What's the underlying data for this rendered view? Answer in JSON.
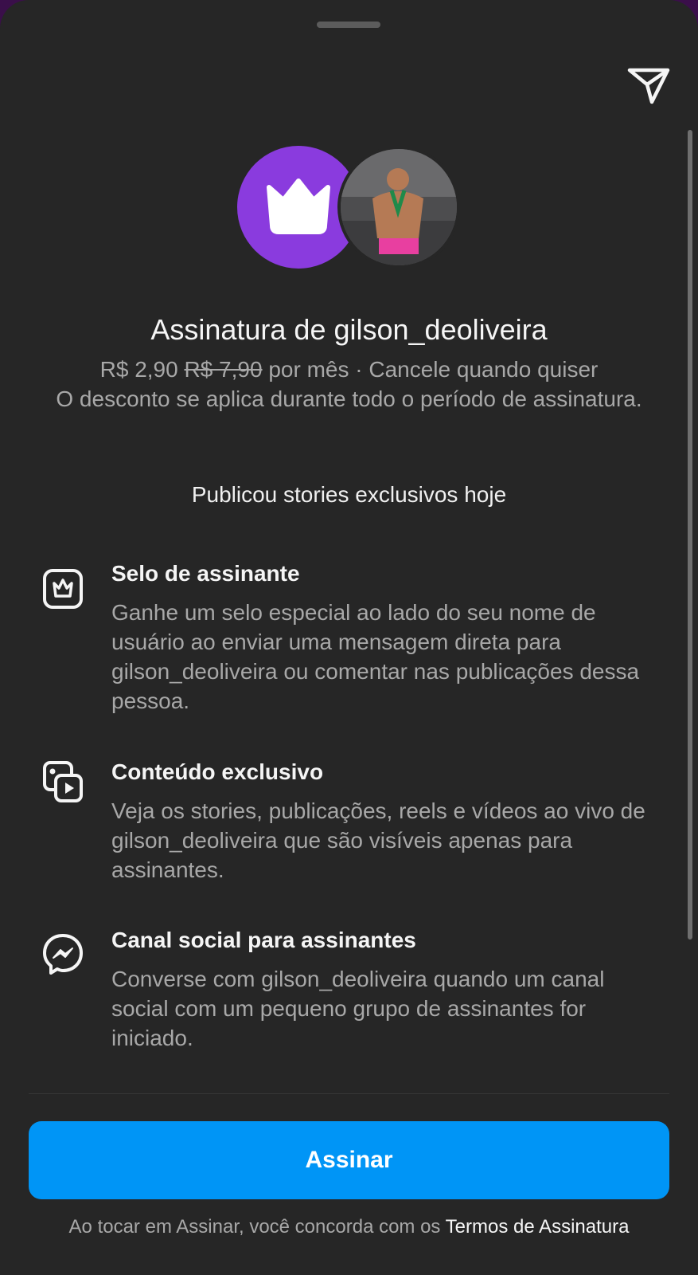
{
  "header": {
    "share_icon": "send-icon"
  },
  "hero": {
    "crown_icon": "crown-icon",
    "avatar_alt": "gilson_deoliveira",
    "accent": "#8a3bde"
  },
  "subscription": {
    "title": "Assinatura de gilson_deoliveira",
    "price": "R$ 2,90",
    "old_price": "R$ 7,90",
    "price_suffix": " por mês · Cancele quando quiser",
    "discount_note": "O desconto se aplica durante todo o período de assinatura.",
    "activity": "Publicou stories exclusivos hoje"
  },
  "features": [
    {
      "icon": "badge-crown-icon",
      "title": "Selo de assinante",
      "description": "Ganhe um selo especial ao lado do seu nome de usuário ao enviar uma mensagem direta para gilson_deoliveira ou comentar nas publicações dessa pessoa."
    },
    {
      "icon": "exclusive-content-icon",
      "title": "Conteúdo exclusivo",
      "description": "Veja os stories, publicações, reels e vídeos ao vivo de gilson_deoliveira que são visíveis apenas para assinantes."
    },
    {
      "icon": "messenger-icon",
      "title": "Canal social para assinantes",
      "description": "Converse com gilson_deoliveira quando um canal social com um pequeno grupo de assinantes for iniciado."
    }
  ],
  "cta": {
    "label": "Assinar",
    "color": "#0095f6"
  },
  "terms": {
    "prefix": "Ao tocar em Assinar, você concorda com os ",
    "link": "Termos de Assinatura"
  }
}
